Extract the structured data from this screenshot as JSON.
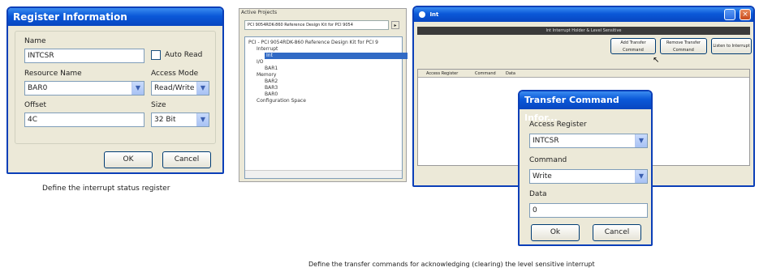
{
  "register_dialog": {
    "title": "Register Information",
    "name_label": "Name",
    "name_value": "INTCSR",
    "auto_read_label": "Auto Read",
    "resource_label": "Resource Name",
    "resource_value": "BAR0",
    "access_mode_label": "Access Mode",
    "access_mode_value": "Read/Write",
    "offset_label": "Offset",
    "offset_value": "4C",
    "size_label": "Size",
    "size_value": "32 Bit",
    "ok_label": "OK",
    "cancel_label": "Cancel"
  },
  "caption_left": "Define the interrupt status register",
  "projects_panel": {
    "title": "Active Projects",
    "tab_label": "PCI 9054RDK-860 Reference Design Kit for PCI 9054",
    "tree": [
      {
        "label": "PCI - PCI 9054RDK-860 Reference Design Kit for PCI 9",
        "indent": 0,
        "selected": false
      },
      {
        "label": "Interrupt",
        "indent": 1,
        "selected": false
      },
      {
        "label": "Int",
        "indent": 2,
        "selected": true
      },
      {
        "label": "I/O",
        "indent": 1,
        "selected": false
      },
      {
        "label": "BAR1",
        "indent": 2,
        "selected": false
      },
      {
        "label": "Memory",
        "indent": 1,
        "selected": false
      },
      {
        "label": "BAR2",
        "indent": 2,
        "selected": false
      },
      {
        "label": "BAR3",
        "indent": 2,
        "selected": false
      },
      {
        "label": "BAR0",
        "indent": 2,
        "selected": false
      },
      {
        "label": "Configuration Space",
        "indent": 1,
        "selected": false
      }
    ]
  },
  "int_window": {
    "title": "Int",
    "header_bar": "Int Interrupt Holder & Level Sensitive",
    "add_button": "Add Transfer Command",
    "remove_button": "Remove Transfer Command",
    "listen_button": "Listen to Interrupt",
    "columns": [
      "Access Register",
      "Command",
      "Data"
    ]
  },
  "transfer_dialog": {
    "title": "Transfer Command Infor...",
    "access_register_label": "Access Register",
    "access_register_value": "INTCSR",
    "command_label": "Command",
    "command_value": "Write",
    "data_label": "Data",
    "data_value": "0",
    "ok_label": "Ok",
    "cancel_label": "Cancel"
  },
  "caption_right": "Define the transfer commands for acknowledging (clearing) the level sensitive interrupt",
  "colors": {
    "xp_blue": "#0a58d8",
    "window_bg": "#ece9d8",
    "selection": "#316ac5"
  }
}
